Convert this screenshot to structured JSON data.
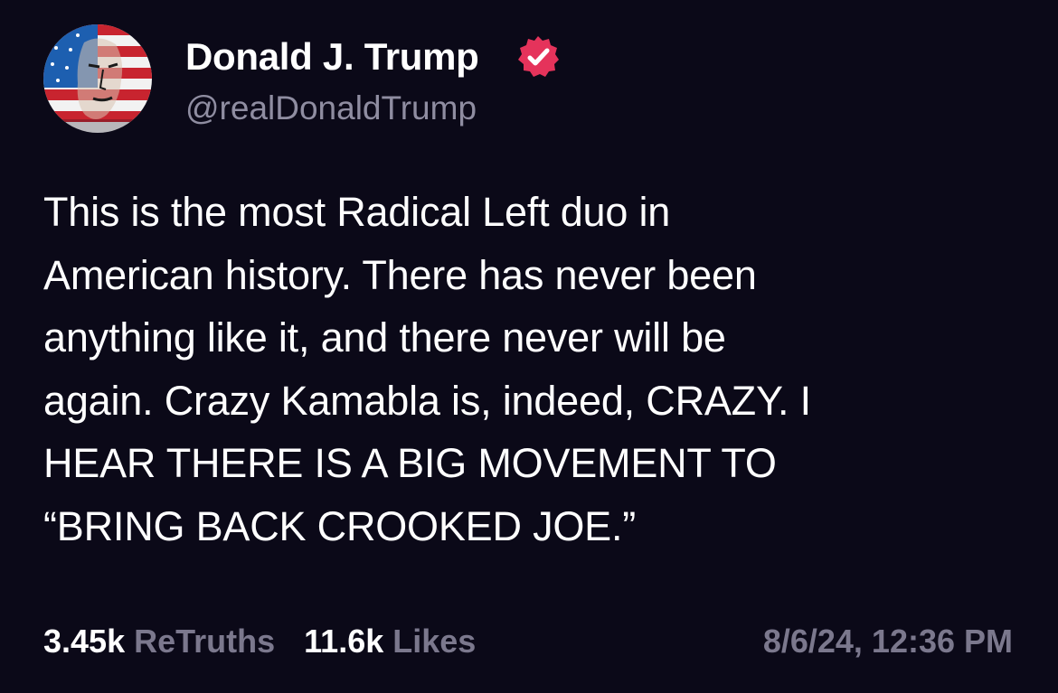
{
  "author": {
    "display_name": "Donald J. Trump",
    "handle": "@realDonaldTrump",
    "verified_icon": "verified-badge-icon",
    "avatar_icon": "avatar-flag-portrait"
  },
  "post": {
    "text": "This is the most Radical Left duo in\nAmerican history. There has never been\nanything like it, and there never will be\nagain. Crazy Kamabla is, indeed, CRAZY. I\nHEAR THERE IS A BIG MOVEMENT TO\n“BRING BACK CROOKED JOE.”"
  },
  "stats": {
    "retruths_count": "3.45k",
    "retruths_label": "ReTruths",
    "likes_count": "11.6k",
    "likes_label": "Likes",
    "timestamp": "8/6/24, 12:36 PM"
  },
  "colors": {
    "background": "#0b0918",
    "text": "#ffffff",
    "muted": "#7b788d",
    "handle": "#8f8da1",
    "verified": "#e5335b"
  }
}
